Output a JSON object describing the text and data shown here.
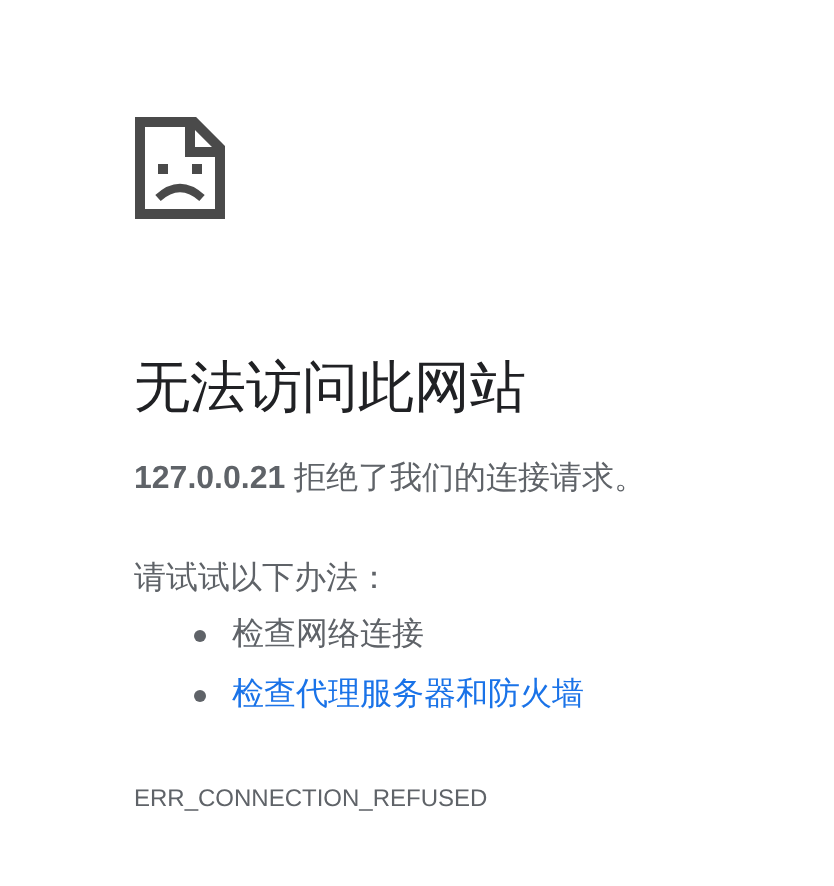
{
  "title": "无法访问此网站",
  "message": "**127.0.0.21** 拒绝了我们的连接请求。",
  "suggestions_heading": "请试试以下办法：",
  "suggestions": [
    {
      "text": "检查网络连接",
      "kind": "text"
    },
    {
      "text": "检查代理服务器和防火墙",
      "kind": "link"
    }
  ],
  "error_code": "ERR_CONNECTION_REFUSED"
}
